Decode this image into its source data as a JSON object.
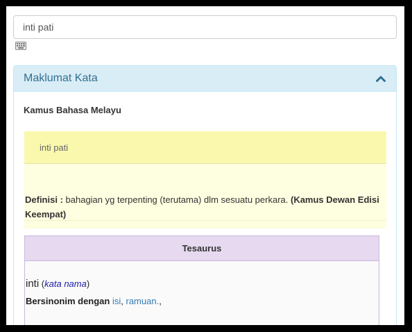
{
  "search": {
    "value": "inti pati"
  },
  "icons": {
    "keyboard": "keyboard-icon",
    "collapse": "chevron-up-icon"
  },
  "colors": {
    "panel_heading_bg": "#d9edf7",
    "panel_title": "#31708f",
    "entry_head_bg": "#faf8ad",
    "entry_bg": "#fefee0",
    "thesaurus_head_bg": "#e6d9f0",
    "link": "#337ab7"
  },
  "panel": {
    "title": "Maklumat Kata",
    "dictionary": "Kamus Bahasa Melayu",
    "entry": {
      "headword": "inti pati",
      "definition_label": "Definisi :",
      "definition_text": " bahagian yg terpenting (terutama) dlm sesuatu perkara. ",
      "source": "(Kamus Dewan Edisi Keempat)"
    },
    "thesaurus": {
      "title": "Tesaurus",
      "word": "inti",
      "pos_open": " (",
      "pos": "kata nama",
      "pos_close": ")",
      "synonym_label": "Bersinonim dengan",
      "synonyms": [
        "isi",
        "ramuan."
      ],
      "separator": ", ",
      "trailing": ","
    }
  }
}
